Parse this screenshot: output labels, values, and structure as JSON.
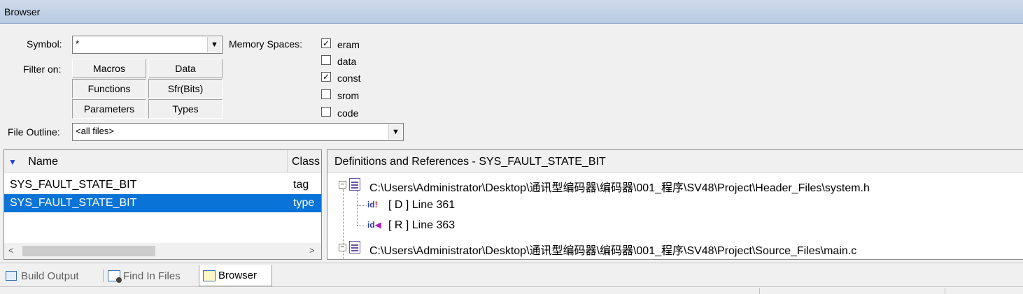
{
  "window": {
    "title": "Browser"
  },
  "symbol": {
    "label": "Symbol:",
    "value": "*"
  },
  "memory_spaces": {
    "label": "Memory Spaces:",
    "items": [
      {
        "label": "eram",
        "checked": true
      },
      {
        "label": "data",
        "checked": false
      },
      {
        "label": "const",
        "checked": true
      },
      {
        "label": "srom",
        "checked": false
      },
      {
        "label": "code",
        "checked": false
      }
    ]
  },
  "filter": {
    "label": "Filter on:",
    "buttons": [
      "Macros",
      "Data",
      "Functions",
      "Sfr(Bits)",
      "Parameters",
      "Types"
    ]
  },
  "file_outline": {
    "label": "File Outline:",
    "value": "<all files>"
  },
  "symbols_table": {
    "columns": [
      "Name",
      "Class"
    ],
    "rows": [
      {
        "name": "SYS_FAULT_STATE_BIT",
        "class": "tag"
      },
      {
        "name": "SYS_FAULT_STATE_BIT",
        "class": "type"
      }
    ]
  },
  "defs": {
    "header": "Definitions and References - SYS_FAULT_STATE_BIT",
    "files": [
      "C:\\Users\\Administrator\\Desktop\\通讯型编码器\\编码器\\001_程序\\SV48\\Project\\Header_Files\\system.h",
      "C:\\Users\\Administrator\\Desktop\\通讯型编码器\\编码器\\001_程序\\SV48\\Project\\Source_Files\\main.c"
    ],
    "refs": [
      "[ D ] Line 361",
      "[ R ] Line 363"
    ]
  },
  "tabs": [
    "Build Output",
    "Find In Files",
    "Browser"
  ],
  "colors": {
    "selection": "#0a73d7",
    "titlebar": "#c4d4e8"
  }
}
